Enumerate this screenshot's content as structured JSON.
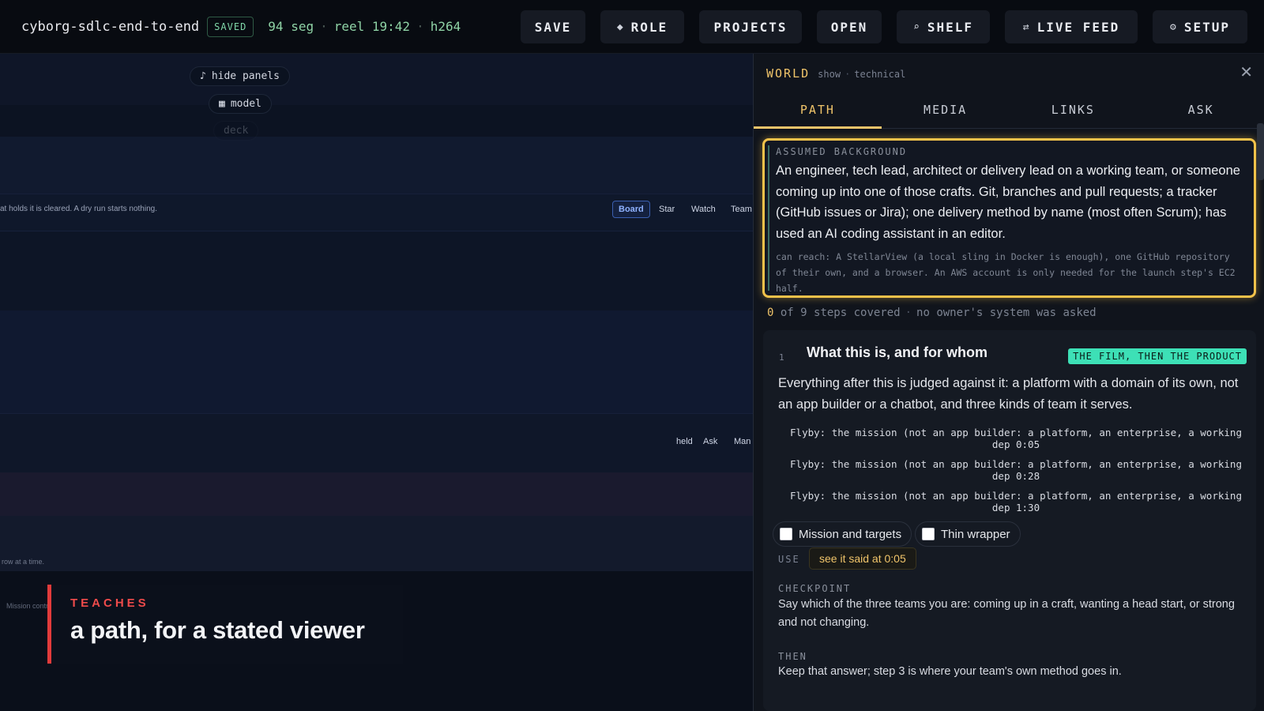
{
  "topbar": {
    "project_name": "cyborg-sdlc-end-to-end",
    "saved_badge": "SAVED",
    "segments": "94 seg",
    "reel": "reel 19:42",
    "codec": "h264",
    "buttons": {
      "save": "SAVE",
      "role": "ROLE",
      "projects": "PROJECTS",
      "open": "OPEN",
      "shelf": "SHELF",
      "live_feed": "LIVE FEED",
      "setup": "SETUP"
    }
  },
  "video": {
    "hide_panels": "hide panels",
    "model": "model",
    "ghost_label": "deck",
    "caption_line": "at holds it is cleared. A dry run starts nothing.",
    "tabs": [
      "Board",
      "Star",
      "Watch",
      "Team"
    ],
    "tabs_lower": [
      "held",
      "Ask",
      "Man"
    ],
    "footer_faint": "row at a time.",
    "footer_faint_2": "Mission control",
    "teaches": {
      "label": "TEACHES",
      "title": "a path, for a stated viewer"
    }
  },
  "panel": {
    "world": "WORLD",
    "sub_show": "show",
    "sub_mode": "technical",
    "tabs": [
      "PATH",
      "MEDIA",
      "LINKS",
      "ASK"
    ],
    "active_tab": "PATH",
    "background": {
      "label": "ASSUMED BACKGROUND",
      "text": "An engineer, tech lead, architect or delivery lead on a working team, or someone coming up into one of those crafts. Git, branches and pull requests; a tracker (GitHub issues or Jira); one delivery method by name (most often Scrum); has used an AI coding assistant in an editor.",
      "reach": "can reach: A StellarView (a local sling in Docker is enough), one GitHub repository of their own, and a browser. An AWS account is only needed for the launch step's EC2 half."
    },
    "coverage": {
      "covered": "0",
      "rest": "of 9 steps covered",
      "note": "no owner's system was asked"
    },
    "step": {
      "number": "1",
      "title": "What this is, and for whom",
      "badge": "THE FILM, THEN THE PRODUCT",
      "body": "Everything after this is judged against it: a platform with a domain of its own, not an app builder or a chatbot, and three kinds of team it serves.",
      "flybys": [
        "Flyby: the mission (not an app builder: a platform, an enterprise, a working dep 0:05",
        "Flyby: the mission (not an app builder: a platform, an enterprise, a working dep 0:28",
        "Flyby: the mission (not an app builder: a platform, an enterprise, a working dep 1:30"
      ],
      "checks": [
        "Mission and targets",
        "Thin wrapper"
      ],
      "use_label": "USE",
      "use_button": "see it said at 0:05",
      "checkpoint_label": "CHECKPOINT",
      "checkpoint_text": "Say which of the three teams you are: coming up in a craft, wanting a head start, or strong and not changing.",
      "then_label": "THEN",
      "then_text": "Keep that answer; step 3 is where your team's own method goes in."
    }
  },
  "colors": {
    "accent_gold": "#f0c46a",
    "highlight_border": "#f2c24a",
    "badge_teal": "#3de0b6",
    "teaches_red": "#e23b3b",
    "meta_green": "#8fd3a6"
  }
}
